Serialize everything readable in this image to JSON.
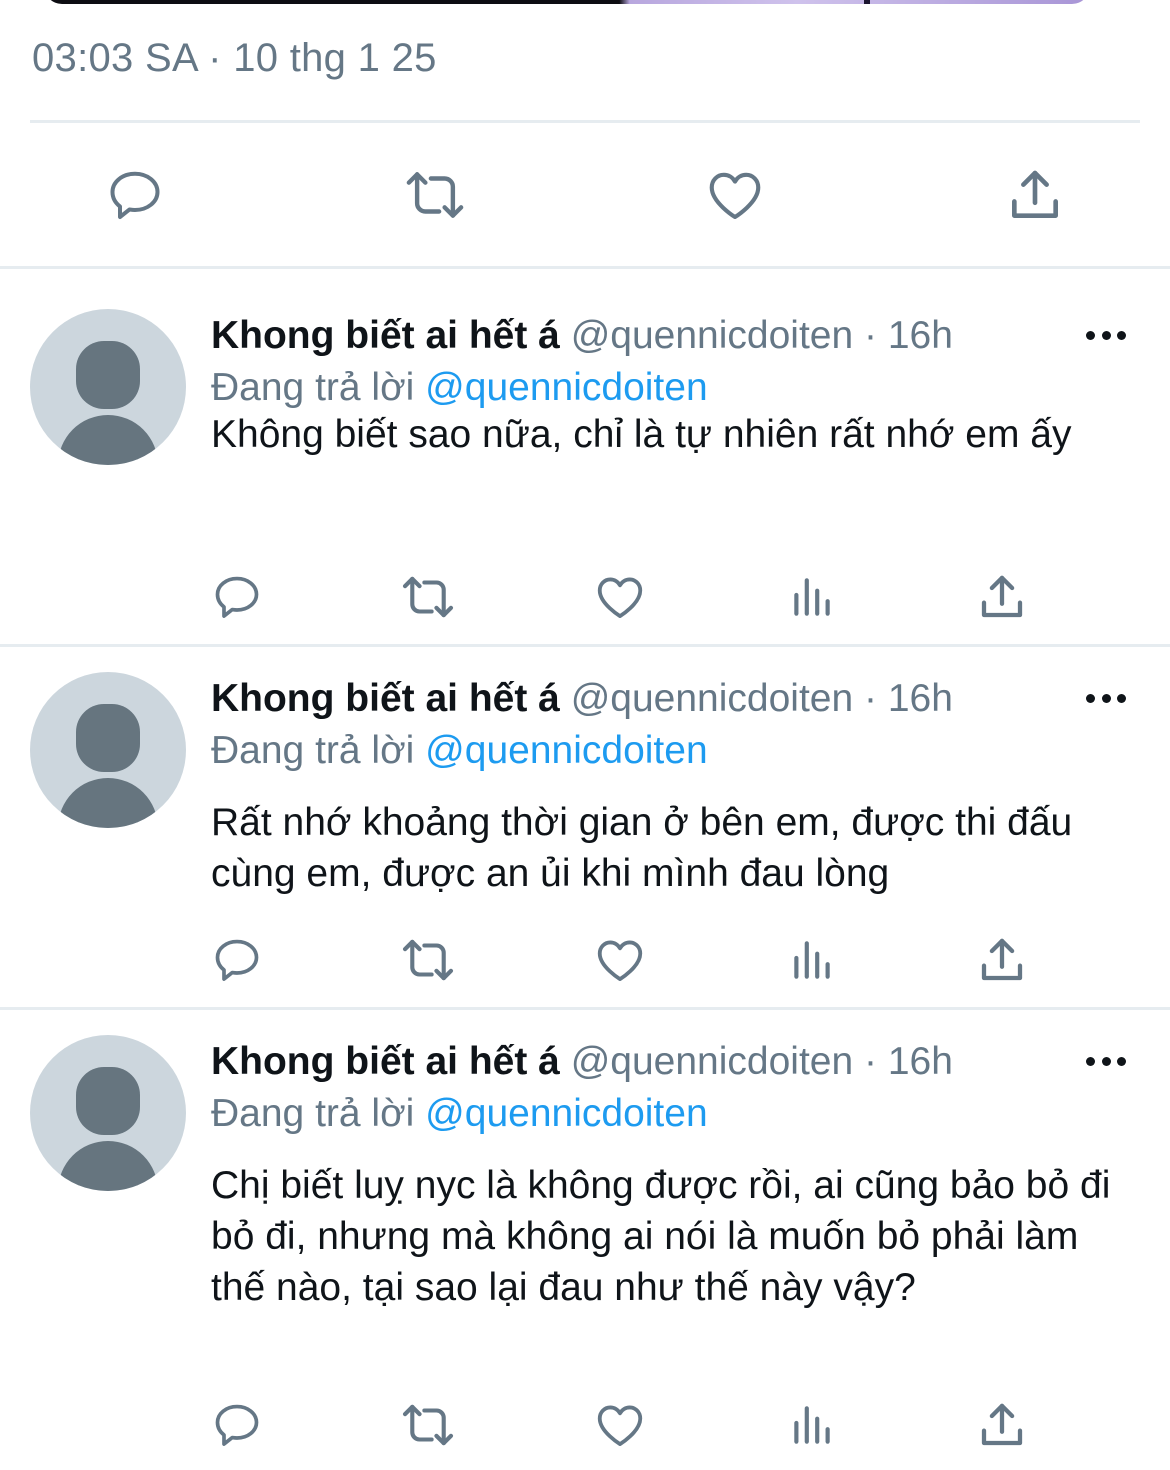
{
  "tweet": {
    "timestamp": "03:03 SA · 10 thg 1 25"
  },
  "icons": {
    "reply": "reply-icon",
    "retweet": "retweet-icon",
    "like": "heart-icon",
    "views": "analytics-icon",
    "share": "share-icon",
    "more": "more-icon"
  },
  "colors": {
    "text": "#0f1419",
    "secondary": "#657786",
    "accent": "#1d9bf0",
    "divider": "#e6ecf0",
    "avatar_bg": "#ccd6dd"
  },
  "replies": [
    {
      "name": "Khong biết ai hết á",
      "handle": "@quennicdoiten",
      "separator": "·",
      "time": "16h",
      "replying_prefix": "Đang trả lời",
      "replying_to": "@quennicdoiten",
      "text": "Không biết sao nữa, chỉ là tự nhiên rất nhớ em ấy"
    },
    {
      "name": "Khong biết ai hết á",
      "handle": "@quennicdoiten",
      "separator": "·",
      "time": "16h",
      "replying_prefix": "Đang trả lời",
      "replying_to": "@quennicdoiten",
      "text": "Rất nhớ khoảng thời gian ở bên em, được thi đấu cùng em, được an ủi khi mình đau lòng"
    },
    {
      "name": "Khong biết ai hết á",
      "handle": "@quennicdoiten",
      "separator": "·",
      "time": "16h",
      "replying_prefix": "Đang trả lời",
      "replying_to": "@quennicdoiten",
      "text": "Chị biết luỵ nyc là không được rồi, ai cũng bảo bỏ đi bỏ đi, nhưng mà không ai nói là muốn bỏ phải làm thế nào, tại sao lại đau như thế này vậy?"
    }
  ]
}
